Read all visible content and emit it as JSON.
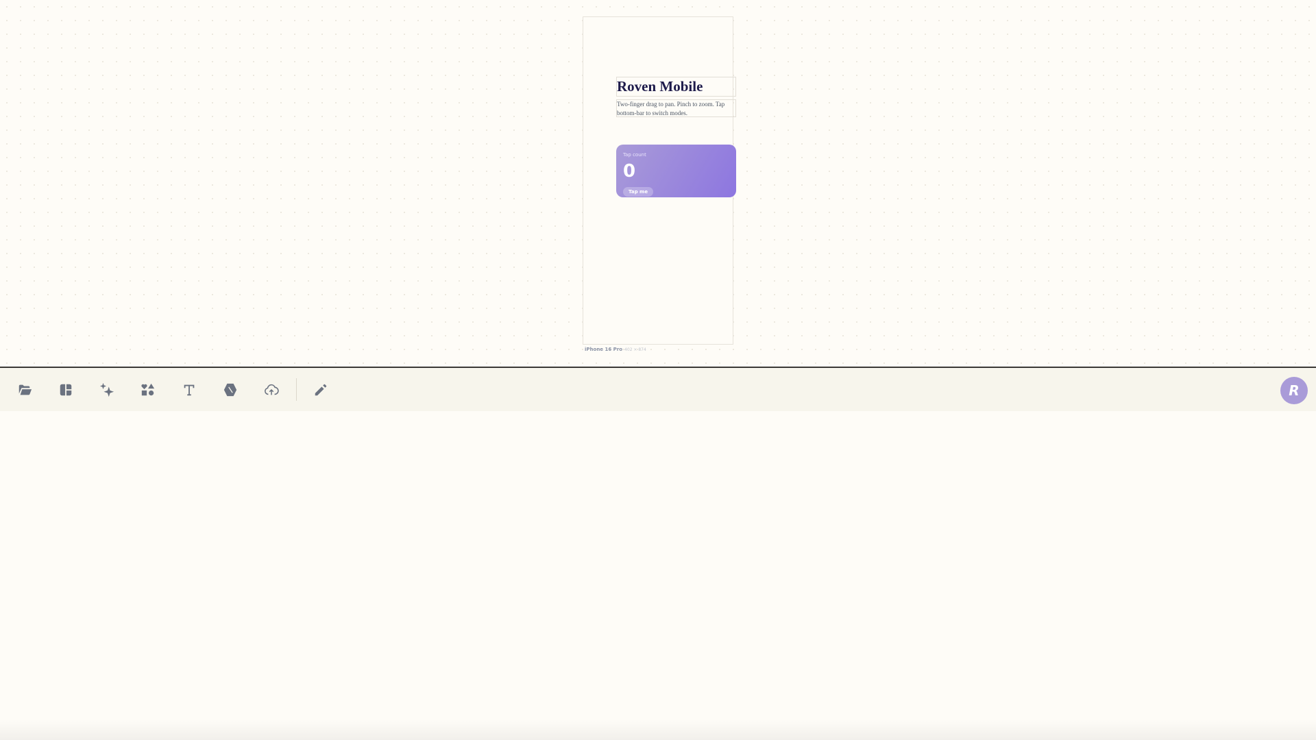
{
  "canvas": {
    "title": "Roven Mobile",
    "description": "Two-finger drag to pan. Pinch to zoom. Tap bottom-bar to switch modes.",
    "card": {
      "label": "Tap count",
      "count": "0",
      "button": "Tap me",
      "gradient": [
        "#a99bd8",
        "#8d76e0"
      ]
    },
    "device": {
      "name": "iPhone 16 Pro",
      "size": "402 × 874"
    }
  },
  "toolbar": {
    "tools": [
      "folder-icon",
      "layout-icon",
      "sparkles-icon",
      "shapes-icon",
      "text-icon",
      "mask-icon",
      "cloud-upload-icon",
      "pencil-icon"
    ],
    "avatar_letter": "R",
    "accent": "#a99bd8"
  }
}
